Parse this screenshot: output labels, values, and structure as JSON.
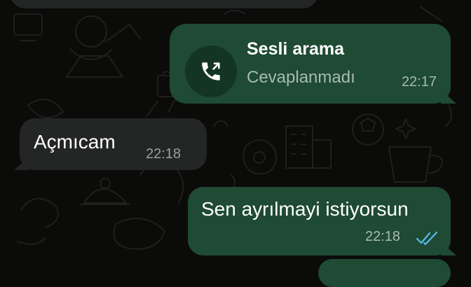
{
  "chat": {
    "top_partial_message": "",
    "call_message": {
      "title": "Sesli arama",
      "status": "Cevaplanmadı",
      "time": "22:17",
      "icon": "outgoing-call-icon"
    },
    "incoming_message": {
      "text": "Açmıcam",
      "time": "22:18"
    },
    "outgoing_message": {
      "text": "Sen ayrılmayi istiyorsun",
      "time": "22:18",
      "status_icon": "double-check-read-icon"
    }
  },
  "colors": {
    "background": "#0b0b0a",
    "incoming_bubble": "#242626",
    "outgoing_bubble": "#1f4a33",
    "read_ticks": "#53bdeb"
  }
}
